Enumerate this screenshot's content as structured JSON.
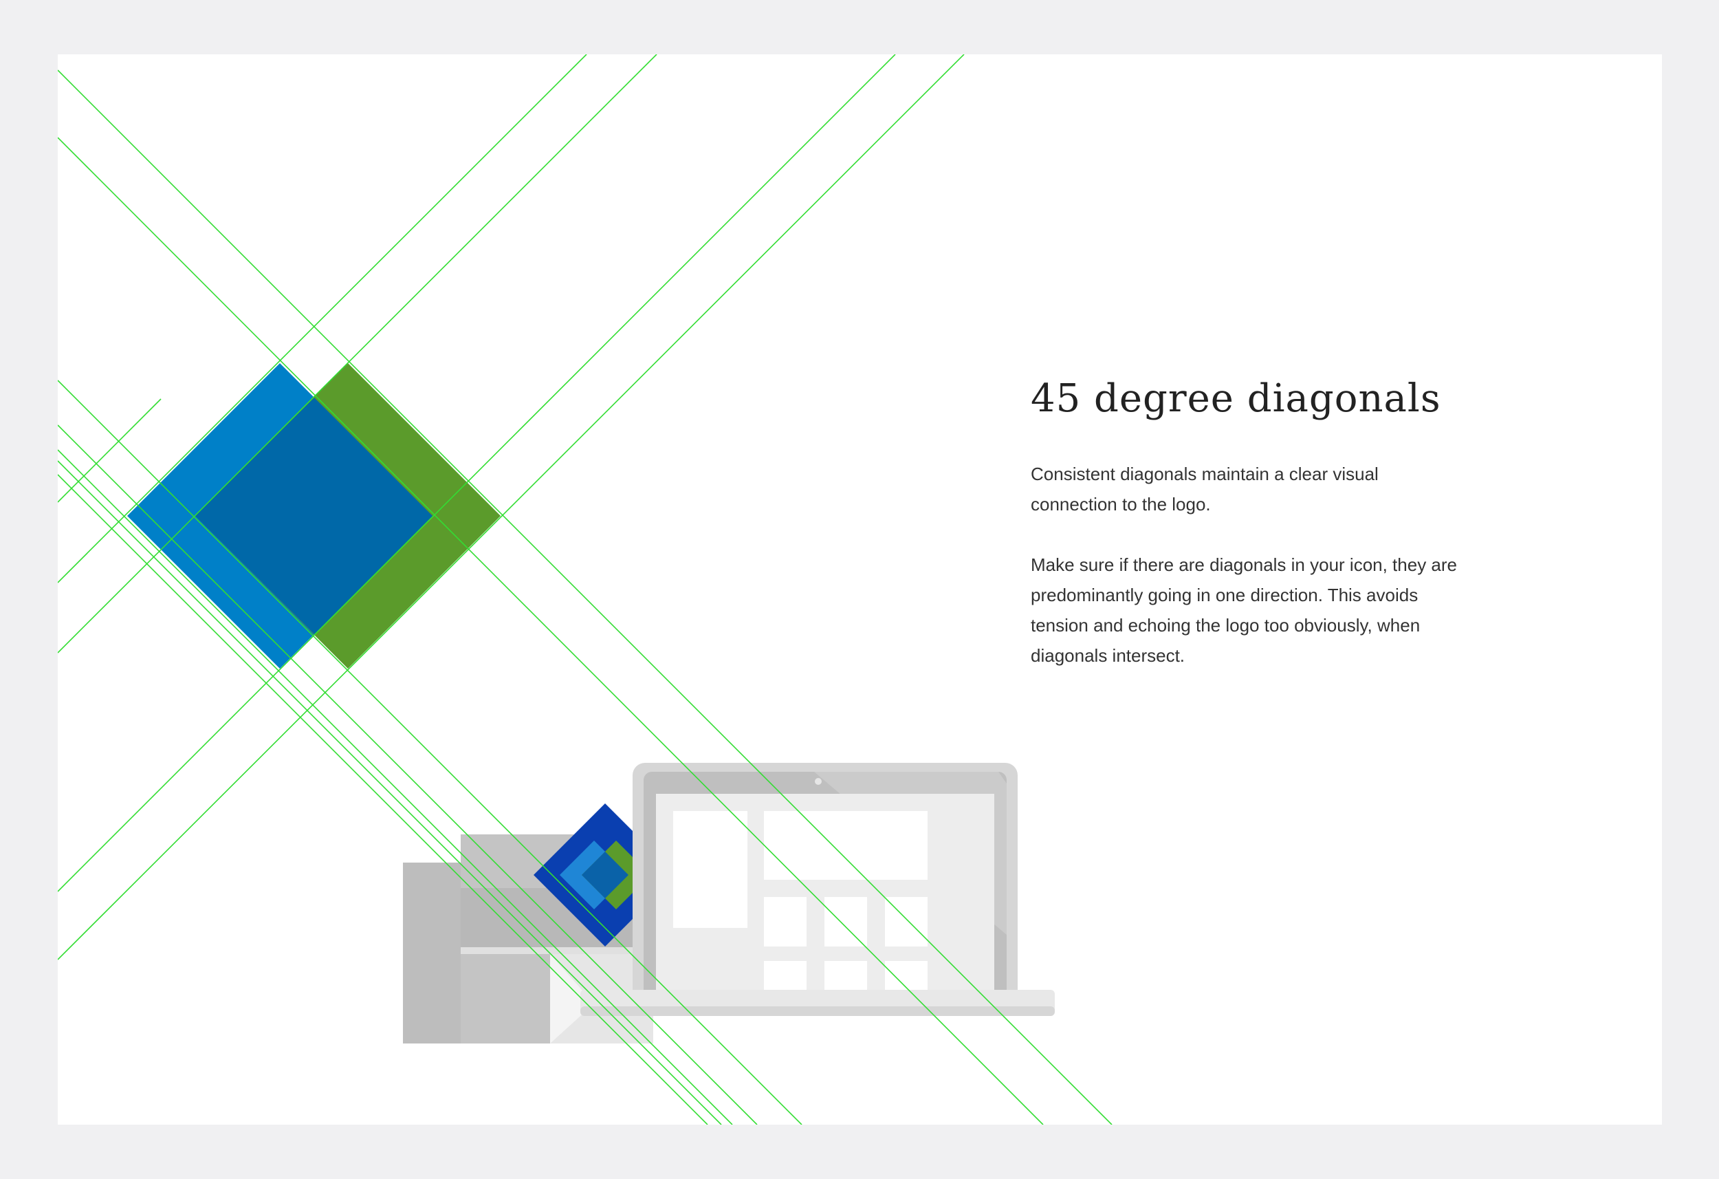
{
  "content": {
    "title": "45 degree diagonals",
    "paragraph_1": "Consistent diagonals maintain a clear visual connection to the logo.",
    "paragraph_2": "Make sure if there are diagonals in your icon, they are predominantly going in one direction. This avoids tension and echoing the logo too obviously, when diagonals intersect."
  },
  "colors": {
    "background": "#f0f0f2",
    "card": "#ffffff",
    "guide_lines": "#33dd33",
    "logo_blue": "#0080c8",
    "logo_dark_blue": "#0068a8",
    "logo_green": "#5b9b2b",
    "icon_navy": "#0a3fb0",
    "device_grey": "#bdbdbd",
    "screen_light": "#ececec"
  },
  "icons": [
    "diamond-logo-icon",
    "laptop-icon",
    "building-icon",
    "small-diamond-icon"
  ]
}
